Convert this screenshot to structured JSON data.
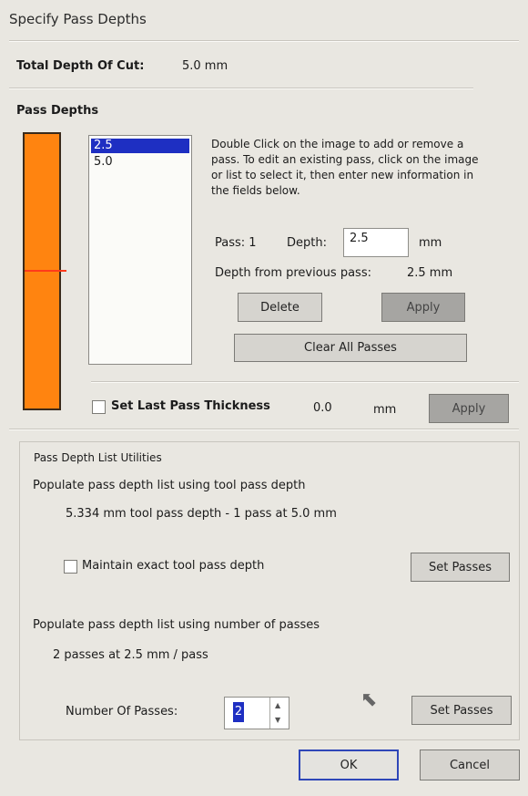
{
  "window": {
    "title": "Specify Pass Depths"
  },
  "summary": {
    "total_depth_label": "Total Depth Of Cut:",
    "total_depth_value": "5.0 mm"
  },
  "pass_depths": {
    "section_label": "Pass Depths",
    "items": [
      "2.5",
      "5.0"
    ],
    "selected_index": 0,
    "help_text": "Double Click on the image to add or remove a pass. To edit an existing pass, click on the image or list to select it, then enter new information in the fields below.",
    "pass_label": "Pass: 1",
    "depth_label": "Depth:",
    "depth_value": "2.5",
    "depth_unit": "mm",
    "from_previous_label": "Depth from previous pass:",
    "from_previous_value": "2.5 mm",
    "delete_button": "Delete",
    "apply_button": "Apply",
    "clear_all_button": "Clear All Passes"
  },
  "last_pass": {
    "checkbox_label": "Set Last Pass Thickness",
    "value": "0.0",
    "unit": "mm",
    "apply_button": "Apply",
    "checked": false
  },
  "utilities": {
    "group_label": "Pass Depth List Utilities",
    "tool_heading": "Populate pass depth list using tool pass depth",
    "tool_summary": "5.334 mm tool pass depth - 1 pass at 5.0 mm",
    "maintain_label": "Maintain exact tool pass depth",
    "maintain_checked": false,
    "set_passes_1": "Set Passes",
    "number_heading": "Populate pass depth list using number of passes",
    "number_summary": "2 passes at 2.5 mm / pass",
    "number_label": "Number Of Passes:",
    "number_value": "2",
    "set_passes_2": "Set Passes"
  },
  "footer": {
    "ok_button": "OK",
    "cancel_button": "Cancel"
  },
  "colors": {
    "depth_bar": "#ff8410",
    "selection": "#1e2fc2",
    "ok_border": "#2e46b8"
  }
}
